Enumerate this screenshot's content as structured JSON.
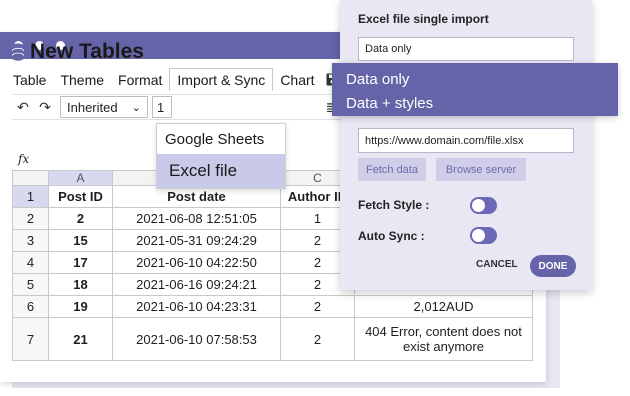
{
  "window": {
    "title": "New Tables"
  },
  "menu": {
    "items": [
      "Table",
      "Theme",
      "Format",
      "Import & Sync",
      "Chart"
    ]
  },
  "toolbar": {
    "font_select": "Inherited",
    "size_value": "1",
    "undo_icon": "undo-icon",
    "redo_icon": "redo-icon"
  },
  "formula_symbol": "fx",
  "sync_menu": {
    "options": [
      "Google Sheets",
      "Excel file"
    ],
    "selected": "Excel file"
  },
  "grid": {
    "column_headers": [
      "A",
      "B",
      "C"
    ],
    "header_row": [
      "1",
      "Post ID",
      "Post date",
      "Author ID"
    ],
    "rows": [
      {
        "row": "2",
        "post_id": "2",
        "post_date": "2021-06-08 12:51:05",
        "author_id": "1",
        "extra": ""
      },
      {
        "row": "3",
        "post_id": "15",
        "post_date": "2021-05-31 09:24:29",
        "author_id": "2",
        "extra": ""
      },
      {
        "row": "4",
        "post_id": "17",
        "post_date": "2021-06-10 04:22:50",
        "author_id": "2",
        "extra": ""
      },
      {
        "row": "5",
        "post_id": "18",
        "post_date": "2021-06-16 09:24:21",
        "author_id": "2",
        "extra": ""
      },
      {
        "row": "6",
        "post_id": "19",
        "post_date": "2021-06-10 04:23:31",
        "author_id": "2",
        "extra": "2,012AUD"
      },
      {
        "row": "7",
        "post_id": "21",
        "post_date": "2021-06-10 07:58:53",
        "author_id": "2",
        "extra": "404 Error, content does not exist anymore"
      }
    ]
  },
  "dialog": {
    "title": "Excel file single import",
    "select_value": "Data only",
    "select_options": [
      "Data only",
      "Data + styles"
    ],
    "url_value": "https://www.domain.com/file.xlsx",
    "fetch_button": "Fetch data",
    "browse_button": "Browse server",
    "fetch_style_label": "Fetch Style :",
    "auto_sync_label": "Auto Sync :",
    "cancel_label": "CANCEL",
    "done_label": "DONE"
  },
  "colors": {
    "brand": "#6564a9",
    "dialog_bg": "#e8e7f3",
    "selection": "#c9c9ea"
  }
}
